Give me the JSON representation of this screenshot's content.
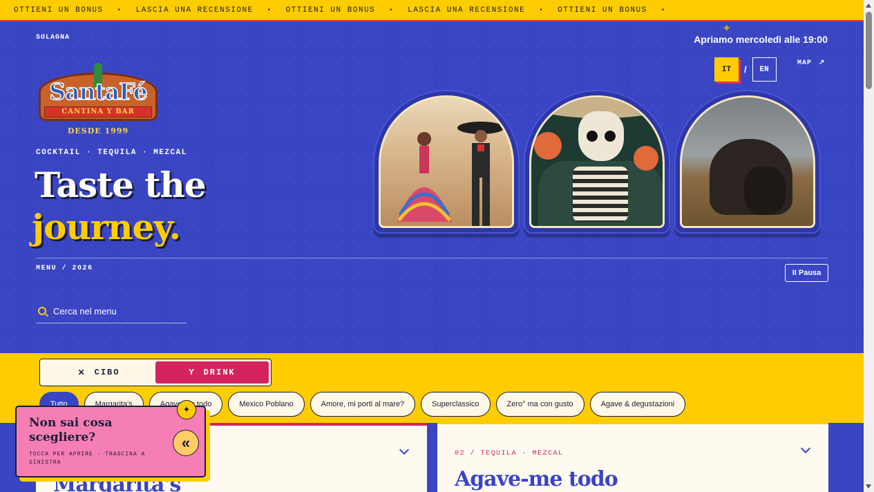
{
  "marquee": {
    "items": [
      "OTTIENI UN BONUS",
      "LASCIA UNA RECENSIONE",
      "OTTIENI UN BONUS",
      "LASCIA UNA RECENSIONE",
      "OTTIENI UN BONUS"
    ],
    "separator": "•"
  },
  "header": {
    "location": "SOLAGNA",
    "opening": "Apriamo mercoledì alle 19:00",
    "lang_it": "IT",
    "lang_sep": "/",
    "lang_en": "EN",
    "map_label": "MAP",
    "map_icon": "↗"
  },
  "logo": {
    "title": "SantaFé",
    "banner": "CANTINA Y BAR",
    "since": "DESDE 1999"
  },
  "hero": {
    "tagline": "COCKTAIL · TEQUILA · MEZCAL",
    "headline_line1": "Taste the",
    "headline_line2": "journey.",
    "menu_year": "MENU / 2026",
    "pause_label": "II Pausa",
    "sparkle_icon": "✦"
  },
  "search": {
    "placeholder": "Cerca nel menu"
  },
  "toggle": {
    "food_label": "CIBO",
    "drink_label": "DRINK",
    "food_icon": "✕",
    "drink_icon": "Y"
  },
  "categories": [
    "Tutto",
    "Margarita's",
    "Agave-me todo",
    "Mexico Poblano",
    "Amore, mi porti al mare?",
    "Superclassico",
    "Zero° ma con gusto",
    "Agave & degustazioni"
  ],
  "cards": [
    {
      "meta": "",
      "title": "Margarita's"
    },
    {
      "meta": "02 / TEQUILA · MEZCAL",
      "title": "Agave-me todo"
    }
  ],
  "helper": {
    "title": "Non sai cosa scegliere?",
    "subtitle": "TOCCA PER APRIRE · TRASCINA A SINISTRA",
    "button_icon": "«",
    "star_icon": "✦"
  },
  "colors": {
    "brand_blue": "#3a45c4",
    "brand_yellow": "#ffcc00",
    "brand_pink": "#d42460",
    "helper_pink": "#f57fb4"
  }
}
